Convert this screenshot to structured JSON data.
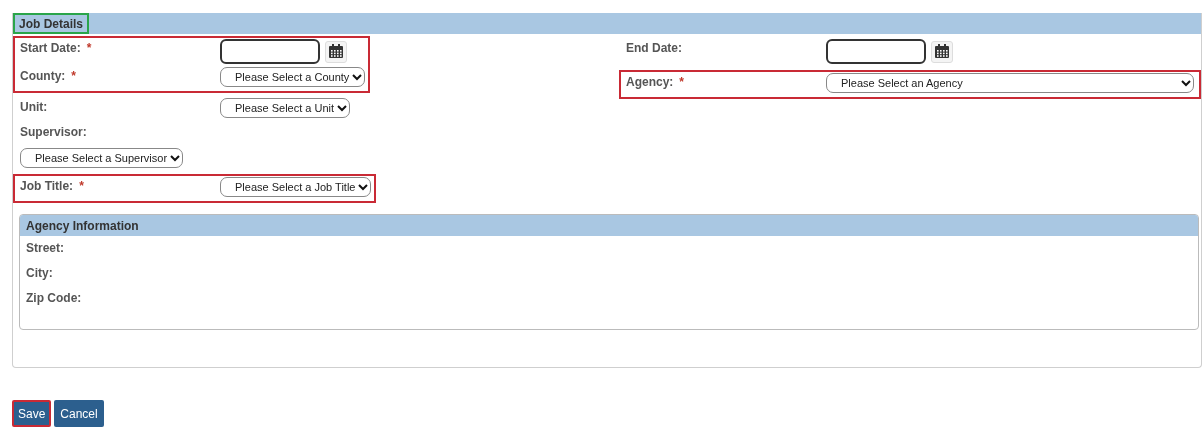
{
  "panel": {
    "title": "Job Details",
    "title_highlighted": true
  },
  "left_groups": [
    {
      "highlighted": true,
      "fields": [
        {
          "kind": "date",
          "label": "Start Date:",
          "mark": "*"
        },
        {
          "kind": "select",
          "label": "County:",
          "mark": "*",
          "value": "Please Select a County"
        }
      ]
    },
    {
      "highlighted": false,
      "fields": [
        {
          "kind": "select",
          "label": "Unit:",
          "value": "Please Select a Unit"
        },
        {
          "kind": "stacked-select",
          "label": "Supervisor:",
          "value": "Please Select a Supervisor"
        }
      ]
    },
    {
      "highlighted": true,
      "fields": [
        {
          "kind": "select",
          "label": "Job Title:",
          "mark": "*",
          "value": "Please Select a Job Title"
        }
      ]
    }
  ],
  "right_groups": [
    {
      "highlighted": false,
      "fields": [
        {
          "kind": "date",
          "label": "End Date:"
        }
      ]
    },
    {
      "highlighted": true,
      "fields": [
        {
          "kind": "wide-select",
          "label": "Agency:",
          "mark": "*",
          "value": "Please Select an Agency"
        }
      ]
    }
  ],
  "agency_info": {
    "title": "Agency Information",
    "fields": [
      "Street:",
      "City:",
      "Zip Code:"
    ]
  },
  "buttons": [
    {
      "label": "Save",
      "highlighted": true
    },
    {
      "label": "Cancel",
      "highlighted": false
    }
  ]
}
